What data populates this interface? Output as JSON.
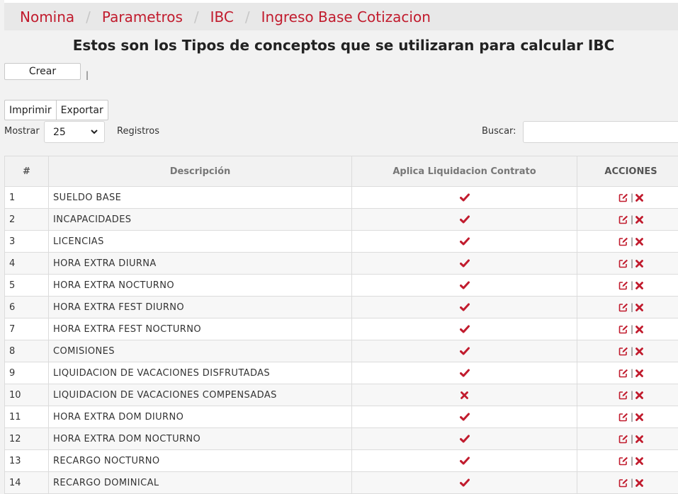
{
  "breadcrumb": [
    "Nomina",
    "Parametros",
    "IBC",
    "Ingreso Base Cotizacion"
  ],
  "page_title": "Estos son los Tipos de conceptos que se utilizaran para calcular IBC",
  "toolbar": {
    "crear_label": "Crear",
    "pipe": "|"
  },
  "export_buttons": {
    "imprimir": "Imprimir",
    "exportar": "Exportar"
  },
  "length_control": {
    "prefix": "Mostrar",
    "value": "25",
    "suffix": "Registros"
  },
  "search": {
    "label": "Buscar:",
    "value": ""
  },
  "table": {
    "headers": [
      "#",
      "Descripción",
      "Aplica Liquidacion Contrato",
      "ACCIONES"
    ],
    "rows": [
      {
        "num": "1",
        "desc": "SUELDO BASE",
        "aplica": true
      },
      {
        "num": "2",
        "desc": "INCAPACIDADES",
        "aplica": true
      },
      {
        "num": "3",
        "desc": "LICENCIAS",
        "aplica": true
      },
      {
        "num": "4",
        "desc": "HORA EXTRA DIURNA",
        "aplica": true
      },
      {
        "num": "5",
        "desc": "HORA EXTRA NOCTURNO",
        "aplica": true
      },
      {
        "num": "6",
        "desc": "HORA EXTRA FEST DIURNO",
        "aplica": true
      },
      {
        "num": "7",
        "desc": "HORA EXTRA FEST NOCTURNO",
        "aplica": true
      },
      {
        "num": "8",
        "desc": "COMISIONES",
        "aplica": true
      },
      {
        "num": "9",
        "desc": "LIQUIDACION DE VACACIONES DISFRUTADAS",
        "aplica": true
      },
      {
        "num": "10",
        "desc": "LIQUIDACION DE VACACIONES COMPENSADAS",
        "aplica": false
      },
      {
        "num": "11",
        "desc": "HORA EXTRA DOM DIURNO",
        "aplica": true
      },
      {
        "num": "12",
        "desc": "HORA EXTRA DOM NOCTURNO",
        "aplica": true
      },
      {
        "num": "13",
        "desc": "RECARGO NOCTURNO",
        "aplica": true
      },
      {
        "num": "14",
        "desc": "RECARGO DOMINICAL",
        "aplica": true
      }
    ],
    "action_separator": "|"
  },
  "colors": {
    "accent": "#c11b2d",
    "breadcrumb_bg": "#e8e8e8",
    "separator": "#c7c7c7"
  },
  "icons": {
    "yes": "check-icon",
    "no": "x-icon",
    "edit": "edit-icon",
    "delete": "delete-icon"
  }
}
